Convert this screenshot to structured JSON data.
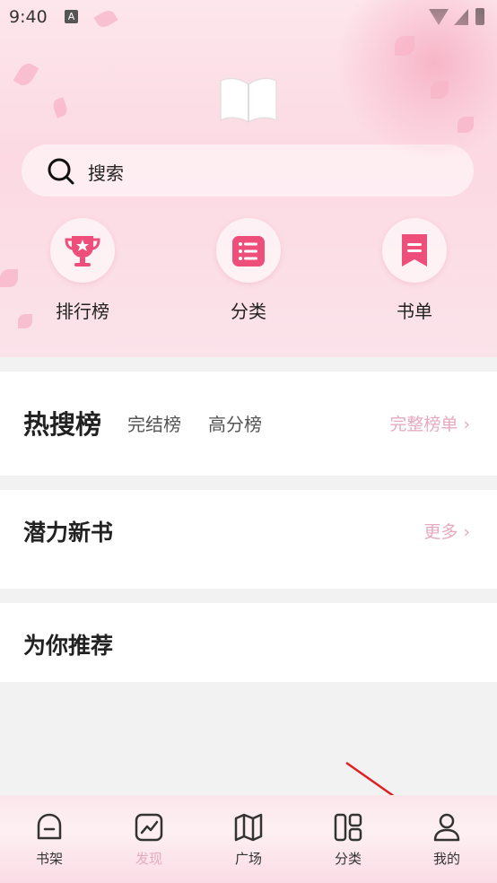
{
  "status_bar": {
    "time": "9:40",
    "badge": "A"
  },
  "search": {
    "placeholder": "搜索"
  },
  "quick_links": [
    {
      "label": "排行榜",
      "icon": "trophy-icon"
    },
    {
      "label": "分类",
      "icon": "list-icon"
    },
    {
      "label": "书单",
      "icon": "bookmark-icon"
    }
  ],
  "hot_section": {
    "title": "热搜榜",
    "tabs": [
      "完结榜",
      "高分榜"
    ],
    "more": "完整榜单 ›"
  },
  "potential_section": {
    "title": "潜力新书",
    "more": "更多 ›"
  },
  "recommend_section": {
    "title": "为你推荐"
  },
  "tabbar": [
    {
      "label": "书架",
      "icon": "bookshelf-icon",
      "active": false
    },
    {
      "label": "发现",
      "icon": "discover-icon",
      "active": true
    },
    {
      "label": "广场",
      "icon": "map-icon",
      "active": false
    },
    {
      "label": "分类",
      "icon": "category-icon",
      "active": false
    },
    {
      "label": "我的",
      "icon": "profile-icon",
      "active": false
    }
  ],
  "colors": {
    "accent": "#ee4f7a",
    "muted_pink": "#e7a9bf",
    "header_bg": "#fcd9e3"
  }
}
